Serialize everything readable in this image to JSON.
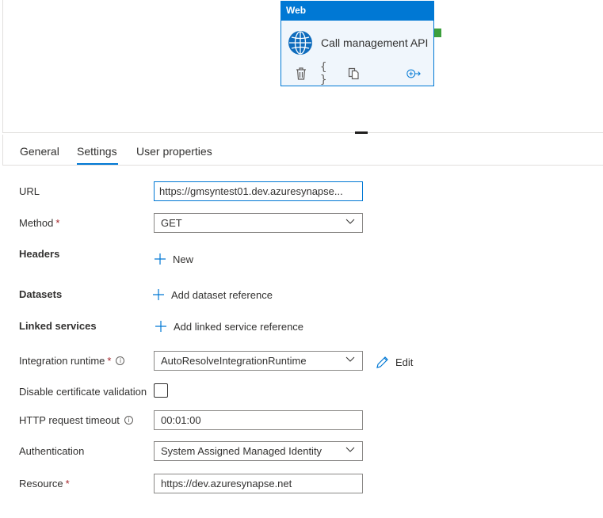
{
  "activity": {
    "type_label": "Web",
    "name": "Call management API",
    "icons": [
      "globe-icon",
      "delete-icon",
      "code-icon",
      "copy-icon",
      "add-output-icon"
    ]
  },
  "tabs": [
    {
      "label": "General"
    },
    {
      "label": "Settings"
    },
    {
      "label": "User properties"
    }
  ],
  "active_tab": "Settings",
  "form": {
    "url": {
      "label": "URL",
      "value": "https://gmsyntest01.dev.azuresynapse..."
    },
    "method": {
      "label": "Method",
      "required": "*",
      "value": "GET"
    },
    "headers": {
      "label": "Headers",
      "action": "New"
    },
    "datasets": {
      "label": "Datasets",
      "action": "Add dataset reference"
    },
    "linked_services": {
      "label": "Linked services",
      "action": "Add linked service reference"
    },
    "integration_runtime": {
      "label": "Integration runtime",
      "required": "*",
      "value": "AutoResolveIntegrationRuntime",
      "edit_label": "Edit"
    },
    "disable_cert": {
      "label": "Disable certificate validation",
      "checked": false
    },
    "timeout": {
      "label": "HTTP request timeout",
      "value": "00:01:00"
    },
    "authentication": {
      "label": "Authentication",
      "value": "System Assigned Managed Identity"
    },
    "resource": {
      "label": "Resource",
      "required": "*",
      "value": "https://dev.azuresynapse.net"
    }
  },
  "colors": {
    "accent": "#0078d4",
    "required": "#a4262c",
    "port": "#3c9f3c"
  }
}
